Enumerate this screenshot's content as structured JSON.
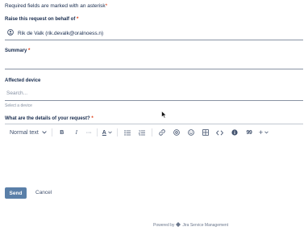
{
  "intro": {
    "text": "Required fields are marked with an asterisk",
    "asterisk": "*"
  },
  "on_behalf": {
    "label": "Raise this request on behalf of",
    "asterisk": "*",
    "value": "Rik de Valk (rik.devalk@oralnoess.n)"
  },
  "summary": {
    "label": "Summary",
    "asterisk": "*",
    "value": ""
  },
  "affected_device": {
    "label": "Affected device",
    "placeholder": "Search...",
    "hint": "Select a device"
  },
  "details": {
    "label": "What are the details of your request?",
    "asterisk": "*",
    "toolbar": {
      "text_style": "Normal text",
      "bold": "B",
      "italic": "I",
      "text_color": "A",
      "more": "···",
      "quote": "99",
      "insert": "+"
    }
  },
  "actions": {
    "send": "Send",
    "cancel": "Cancel"
  },
  "footer": {
    "prefix": "Powered by",
    "brand": "Jira Service Management"
  }
}
